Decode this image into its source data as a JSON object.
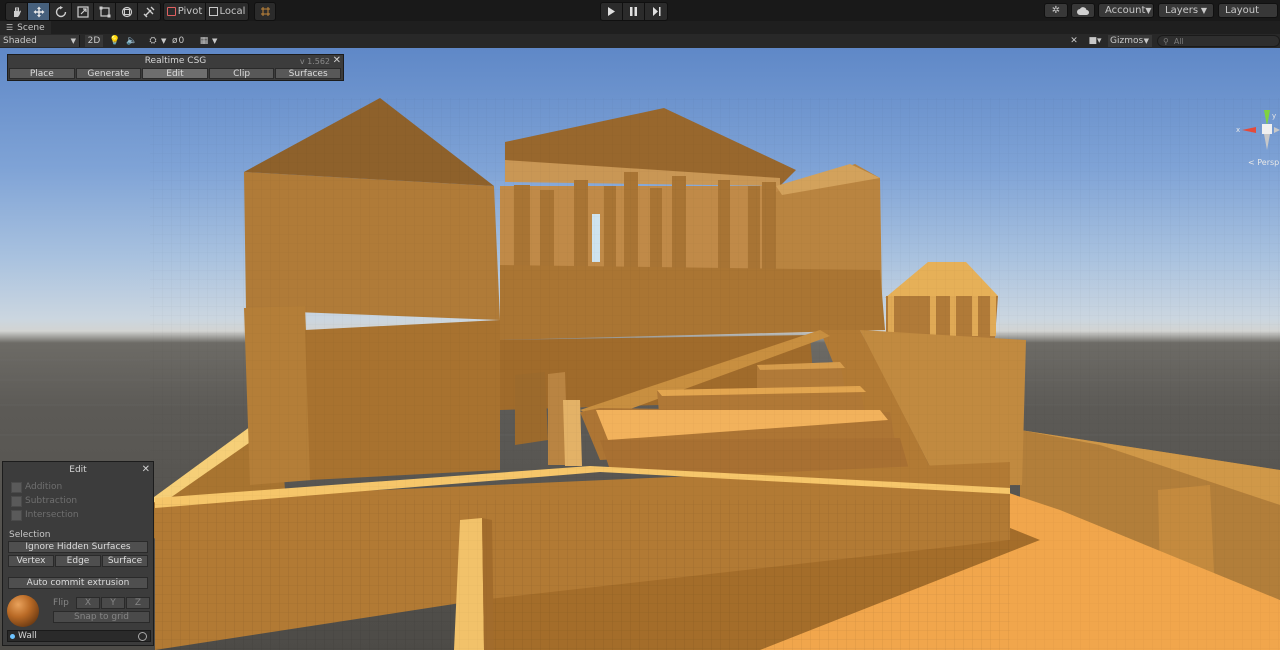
{
  "toolbar": {
    "tools": [
      "hand-icon",
      "move-icon",
      "rotate-icon",
      "scale-icon",
      "rect-icon",
      "transform-icon",
      "custom-tool-icon"
    ],
    "pivot_label": "Pivot",
    "local_label": "Local",
    "snap_icon": "grid-snap-icon",
    "play_icon": "play-icon",
    "pause_icon": "pause-icon",
    "step_icon": "step-icon",
    "services_icon": "services-icon",
    "cloud_icon": "cloud-icon",
    "account_label": "Account",
    "layers_label": "Layers",
    "layout_label": "Layout"
  },
  "scene_tab": {
    "label": "Scene",
    "icon": "menu-icon"
  },
  "scene_bar": {
    "shading": "Shaded",
    "mode2d": "2D",
    "hidden_count": "0",
    "gizmos_label": "Gizmos",
    "search_placeholder": "All"
  },
  "csg_panel": {
    "title": "Realtime CSG",
    "version": "v 1.562",
    "tabs": [
      {
        "label": "Place"
      },
      {
        "label": "Generate"
      },
      {
        "label": "Edit"
      },
      {
        "label": "Clip"
      },
      {
        "label": "Surfaces"
      }
    ],
    "active_tab": "Edit"
  },
  "edit_panel": {
    "title": "Edit",
    "operations": [
      "Addition",
      "Subtraction",
      "Intersection"
    ],
    "selection_label": "Selection",
    "ignore_hidden": "Ignore Hidden Surfaces",
    "modes": [
      "Vertex",
      "Edge",
      "Surface"
    ],
    "auto_commit": "Auto commit extrusion",
    "flip_label": "Flip",
    "flip_axes": [
      "X",
      "Y",
      "Z"
    ],
    "snap_label": "Snap to grid",
    "material": "Wall"
  },
  "view_gizmo": {
    "x_label": "x",
    "y_label": "y",
    "persp_label": "< Persp"
  },
  "colors": {
    "accent": "#46607c",
    "sky": "#7fa3d6",
    "ground": "#5c5a56",
    "stone": "#b67f36"
  }
}
